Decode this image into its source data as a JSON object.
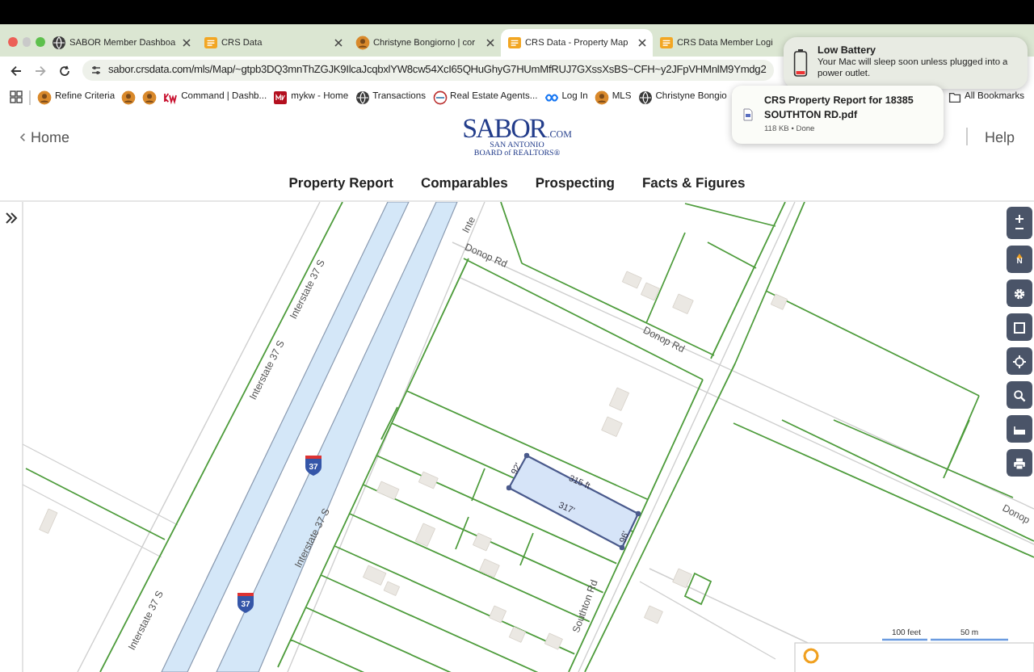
{
  "browser": {
    "tabs": [
      {
        "title": "SABOR Member Dashboa",
        "kind": "globe",
        "selected": false
      },
      {
        "title": "CRS Data",
        "kind": "crs",
        "selected": false
      },
      {
        "title": "Christyne Bongiorno | cor",
        "kind": "avatar",
        "selected": false
      },
      {
        "title": "CRS Data - Property Map",
        "kind": "crs",
        "selected": true
      },
      {
        "title": "CRS Data Member Logi",
        "kind": "crs",
        "selected": false
      }
    ],
    "url": "sabor.crsdata.com/mls/Map/~gtpb3DQ3mnThZGJK9IlcaJcqbxlYW8cw54XcI65QHuGhyG7HUmMfRUJ7GXssXsBS~CFH~y2JFpVHMnlM9Ymdg2",
    "bookmarks": [
      {
        "kind": "avatar",
        "label": "Refine Criteria"
      },
      {
        "kind": "avatar"
      },
      {
        "kind": "avatar"
      },
      {
        "kind": "kw",
        "label": "Command | Dashb..."
      },
      {
        "kind": "square",
        "label": "mykw - Home"
      },
      {
        "kind": "globe",
        "label": "Transactions"
      },
      {
        "kind": "ring",
        "label": "Real Estate Agents..."
      },
      {
        "kind": "meta",
        "label": "Log In"
      },
      {
        "kind": "avatar",
        "label": "MLS"
      },
      {
        "kind": "globe",
        "label": "Christyne Bongio"
      }
    ],
    "all_bookmarks": "All Bookmarks"
  },
  "notification": {
    "title": "Low Battery",
    "body": "Your Mac will sleep soon unless plugged into a power outlet."
  },
  "download": {
    "title": "CRS Property Report for 18385 SOUTHTON RD.pdf",
    "status": "118 KB • Done"
  },
  "site": {
    "home": "Home",
    "help": "Help",
    "logo": {
      "wordmark": "SABOR",
      "suffix": ".COM",
      "line_1": "SAN ANTONIO",
      "line_2": "BOARD of REALTORS®"
    },
    "nav": [
      "Property Report",
      "Comparables",
      "Prospecting",
      "Facts & Figures"
    ]
  },
  "map": {
    "labels": [
      {
        "text": "Inte",
        "kind": "road"
      },
      {
        "text": "Interstate 37 S",
        "kind": "road"
      },
      {
        "text": "Interstate 37 S",
        "kind": "road"
      },
      {
        "text": "Donop Rd",
        "kind": "road"
      },
      {
        "text": "Donop Rd",
        "kind": "road"
      },
      {
        "text": "Interstate 37 S",
        "kind": "road"
      },
      {
        "text": "Interstate 37 S",
        "kind": "road"
      },
      {
        "text": "Southton Rd",
        "kind": "road"
      },
      {
        "text": "Donop",
        "kind": "road"
      },
      {
        "text": "315 ft",
        "kind": "dimension"
      },
      {
        "text": "317'",
        "kind": "dimension"
      },
      {
        "text": "92'",
        "kind": "dimension"
      },
      {
        "text": "96'",
        "kind": "dimension"
      },
      {
        "text": "37",
        "kind": "shield"
      },
      {
        "text": "37",
        "kind": "shield"
      }
    ],
    "scale": [
      "100 feet",
      "50 m"
    ],
    "tools": [
      {
        "kind": "zoom"
      },
      {
        "kind": "compass",
        "label": "N"
      },
      {
        "kind": "gear"
      },
      {
        "kind": "select"
      },
      {
        "kind": "locate"
      },
      {
        "kind": "search"
      },
      {
        "kind": "ruler"
      },
      {
        "kind": "print"
      }
    ]
  }
}
